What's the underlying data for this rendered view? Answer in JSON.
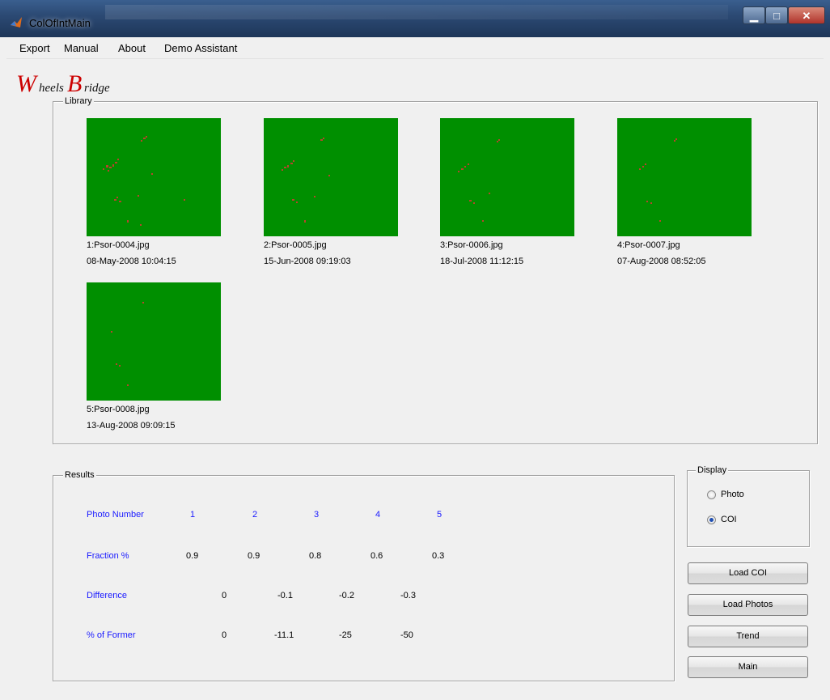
{
  "window": {
    "title": "ColOfIntMain"
  },
  "menu": [
    "Export",
    "Manual",
    "About",
    "Demo Assistant"
  ],
  "logo": {
    "text": "WheelsBridge"
  },
  "library": {
    "label": "Library",
    "photos": [
      {
        "name": "1:Psor-0004.jpg",
        "date": "08-May-2008 10:04:15"
      },
      {
        "name": "2:Psor-0005.jpg",
        "date": "15-Jun-2008 09:19:03"
      },
      {
        "name": "3:Psor-0006.jpg",
        "date": "18-Jul-2008 11:12:15"
      },
      {
        "name": "4:Psor-0007.jpg",
        "date": "07-Aug-2008 08:52:05"
      },
      {
        "name": "5:Psor-0008.jpg",
        "date": "13-Aug-2008 09:09:15"
      }
    ]
  },
  "results": {
    "label": "Results",
    "rows": {
      "photo_number": {
        "label": "Photo Number",
        "values": [
          "1",
          "2",
          "3",
          "4",
          "5"
        ]
      },
      "fraction": {
        "label": "Fraction %",
        "values": [
          "0.9",
          "0.9",
          "0.8",
          "0.6",
          "0.3"
        ]
      },
      "difference": {
        "label": "Difference",
        "values": [
          "0",
          "-0.1",
          "-0.2",
          "-0.3"
        ]
      },
      "pct_former": {
        "label": "% of Former",
        "values": [
          "0",
          "-11.1",
          "-25",
          "-50"
        ]
      }
    }
  },
  "display": {
    "label": "Display",
    "options": [
      {
        "label": "Photo",
        "selected": false
      },
      {
        "label": "COI",
        "selected": true
      }
    ]
  },
  "buttons": {
    "load_coi": "Load COI",
    "load_photos": "Load Photos",
    "trend": "Trend",
    "main": "Main"
  },
  "colors": {
    "thumb_bg": "#008f00",
    "spot": "#b5462b",
    "accent_text": "#1a1aff"
  }
}
